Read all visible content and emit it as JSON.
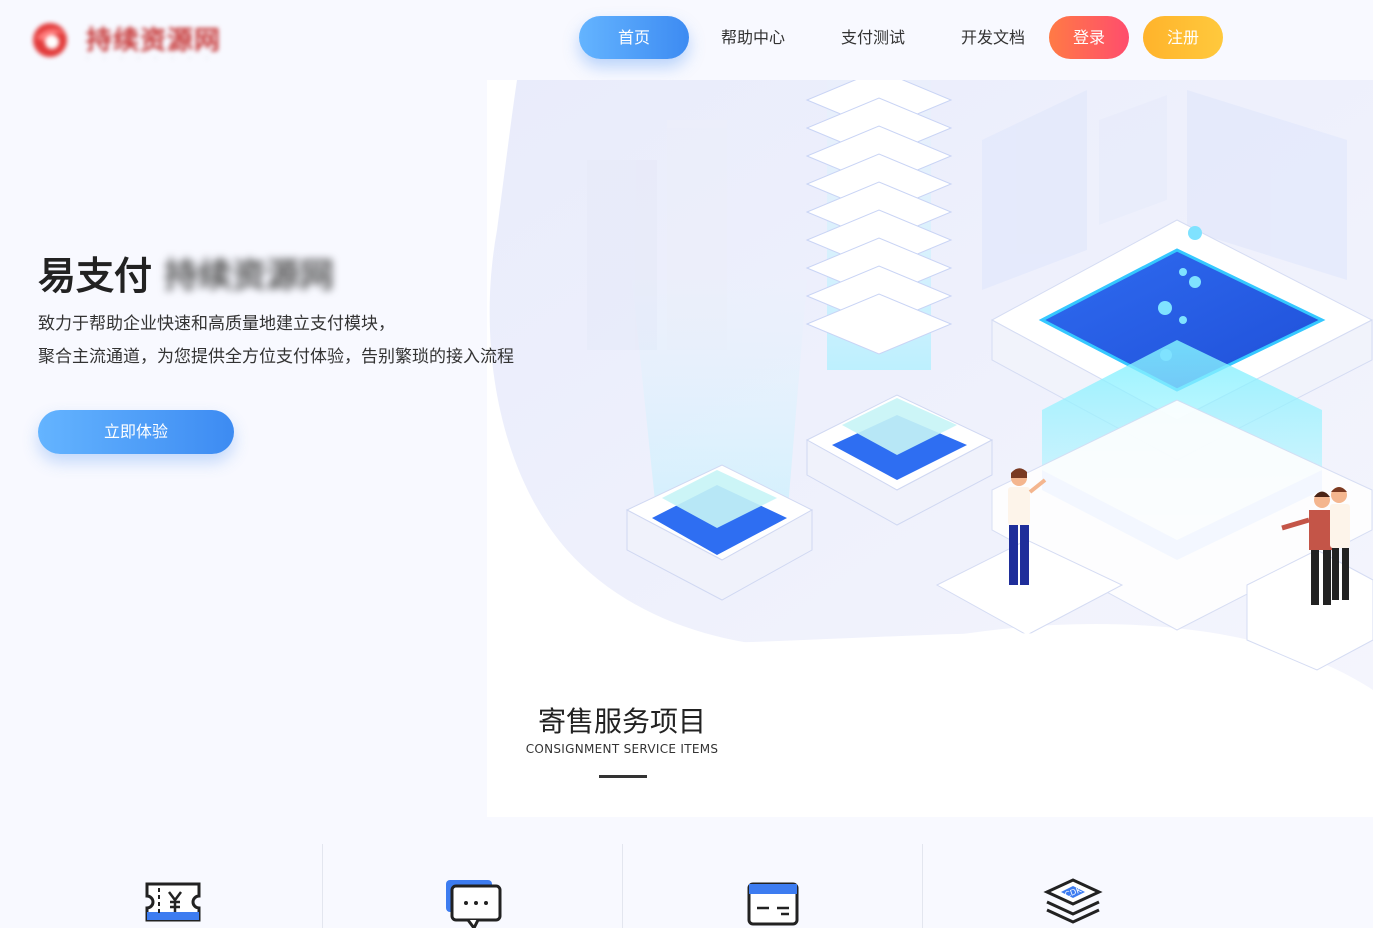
{
  "logo": {
    "name": "持续资源网",
    "tagline": "· · · · · · · ·"
  },
  "nav": {
    "home": "首页",
    "help": "帮助中心",
    "pay_test": "支付测试",
    "docs": "开发文档",
    "login": "登录",
    "register": "注册"
  },
  "hero": {
    "title": "易支付",
    "title_blurred": "持续资源网",
    "line1": "致力于帮助企业快速和高质量地建立支付模块，",
    "line2": "聚合主流通道，为您提供全方位支付体验，告别繁琐的接入流程",
    "cta": "立即体验"
  },
  "section": {
    "title": "寄售服务项目",
    "subtitle": "CONSIGNMENT SERVICE ITEMS"
  },
  "features": [
    {
      "icon": "ticket-yuan-icon"
    },
    {
      "icon": "chat-bubble-icon"
    },
    {
      "icon": "credit-card-icon"
    },
    {
      "icon": "cdk-stack-icon"
    }
  ],
  "colors": {
    "primary": "#3d8bf2",
    "login": "#ff5a5f",
    "register": "#ffb32b",
    "background": "#f8f9ff"
  }
}
